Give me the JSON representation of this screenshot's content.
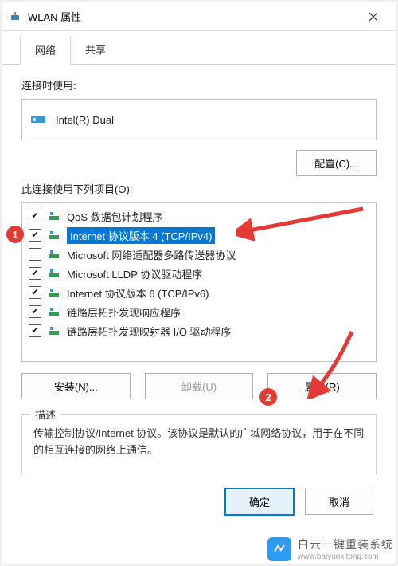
{
  "titlebar": {
    "title": "WLAN 属性"
  },
  "tabs": {
    "network": "网络",
    "sharing": "共享"
  },
  "connect_using": "连接时使用:",
  "adapter_name": "Intel(R) Dual",
  "configure_btn": "配置(C)...",
  "items_label": "此连接使用下列项目(O):",
  "items": [
    {
      "label": "QoS 数据包计划程序",
      "checked": true,
      "selected": false,
      "icon": "net-protocol"
    },
    {
      "label": "Internet 协议版本 4 (TCP/IPv4)",
      "checked": true,
      "selected": true,
      "icon": "net-protocol"
    },
    {
      "label": "Microsoft 网络适配器多路传送器协议",
      "checked": false,
      "selected": false,
      "icon": "net-protocol"
    },
    {
      "label": "Microsoft LLDP 协议驱动程序",
      "checked": true,
      "selected": false,
      "icon": "net-protocol"
    },
    {
      "label": "Internet 协议版本 6 (TCP/IPv6)",
      "checked": true,
      "selected": false,
      "icon": "net-protocol"
    },
    {
      "label": "链路层拓扑发现响应程序",
      "checked": true,
      "selected": false,
      "icon": "net-protocol"
    },
    {
      "label": "链路层拓扑发现映射器 I/O 驱动程序",
      "checked": true,
      "selected": false,
      "icon": "net-protocol"
    }
  ],
  "install_btn": "安装(N)...",
  "uninstall_btn": "卸载(U)",
  "properties_btn": "属性(R)",
  "desc_legend": "描述",
  "desc_text": "传输控制协议/Internet 协议。该协议是默认的广域网络协议，用于在不同的相互连接的网络上通信。",
  "ok_btn": "确定",
  "cancel_btn": "取消",
  "callouts": {
    "one": "1",
    "two": "2"
  },
  "watermark": {
    "cn": "白云一键重装系统",
    "en": "www.baiyunxitong.com"
  }
}
